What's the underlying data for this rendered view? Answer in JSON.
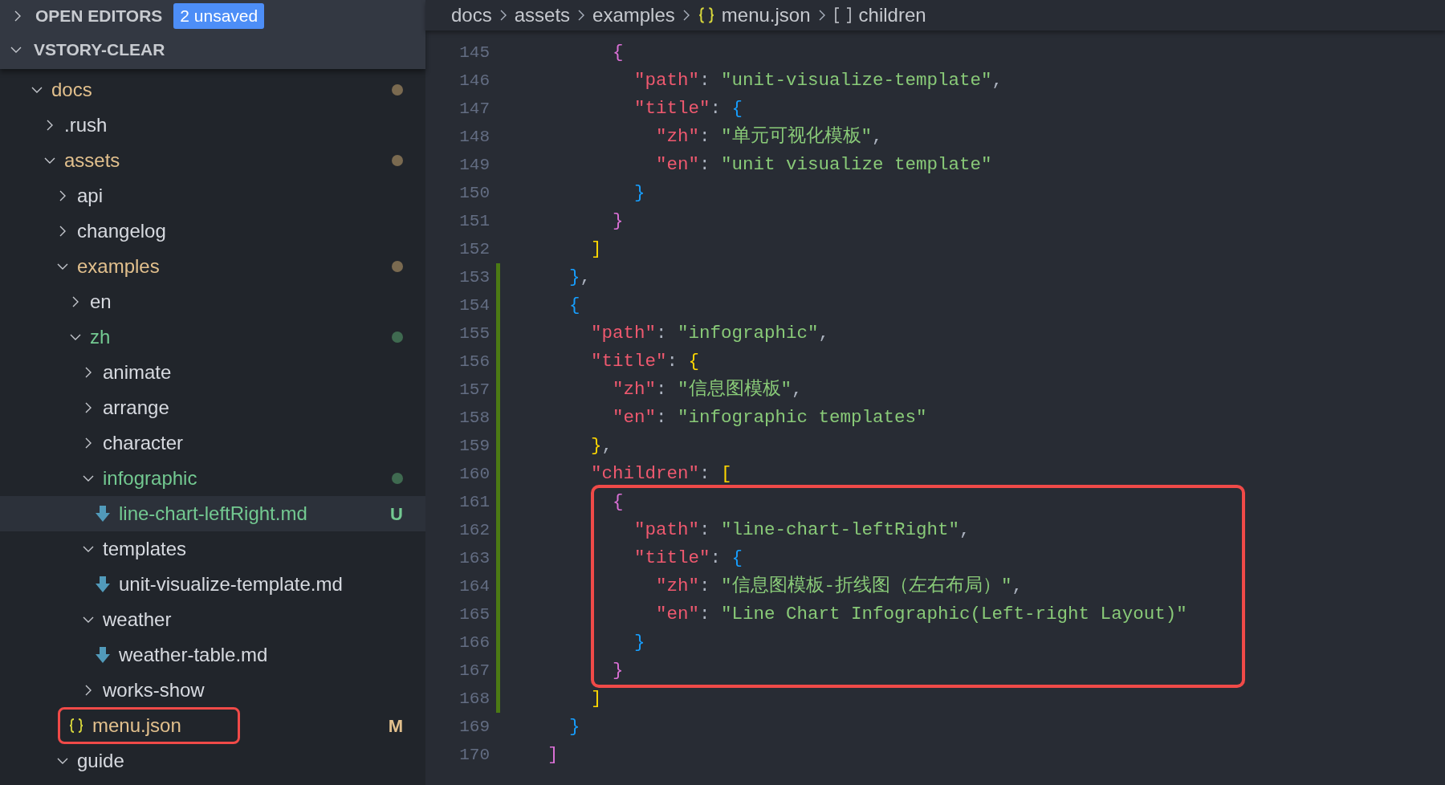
{
  "sidebar": {
    "open_editors": {
      "label": "OPEN EDITORS",
      "expanded": false,
      "badge": "2 unsaved"
    },
    "workspace": {
      "label": "VSTORY-CLEAR",
      "expanded": true
    },
    "tree": [
      {
        "name": "docs",
        "kind": "folder",
        "expanded": true,
        "color": "#e2c08d",
        "dot": {
          "color": "#7a6a50"
        },
        "children": [
          {
            "name": ".rush",
            "kind": "folder",
            "expanded": false
          },
          {
            "name": "assets",
            "kind": "folder",
            "expanded": true,
            "color": "#e2c08d",
            "dot": {
              "color": "#7a6a50"
            },
            "children": [
              {
                "name": "api",
                "kind": "folder",
                "expanded": false
              },
              {
                "name": "changelog",
                "kind": "folder",
                "expanded": false
              },
              {
                "name": "examples",
                "kind": "folder",
                "expanded": true,
                "color": "#e2c08d",
                "dot": {
                  "color": "#7a6a50"
                },
                "children": [
                  {
                    "name": "en",
                    "kind": "folder",
                    "expanded": false
                  },
                  {
                    "name": "zh",
                    "kind": "folder",
                    "expanded": true,
                    "color": "#73c991",
                    "dot": {
                      "color": "#3f6a50"
                    },
                    "children": [
                      {
                        "name": "animate",
                        "kind": "folder",
                        "expanded": false
                      },
                      {
                        "name": "arrange",
                        "kind": "folder",
                        "expanded": false
                      },
                      {
                        "name": "character",
                        "kind": "folder",
                        "expanded": false
                      },
                      {
                        "name": "infographic",
                        "kind": "folder",
                        "expanded": true,
                        "color": "#73c991",
                        "dot": {
                          "color": "#3f6a50"
                        },
                        "children": [
                          {
                            "name": "line-chart-leftRight.md",
                            "kind": "markdown",
                            "color": "#73c991",
                            "letter": "U",
                            "selected": true,
                            "highlighted": false
                          }
                        ]
                      },
                      {
                        "name": "templates",
                        "kind": "folder",
                        "expanded": true,
                        "children": [
                          {
                            "name": "unit-visualize-template.md",
                            "kind": "markdown",
                            "selected": false,
                            "highlighted": false
                          }
                        ]
                      },
                      {
                        "name": "weather",
                        "kind": "folder",
                        "expanded": true,
                        "children": [
                          {
                            "name": "weather-table.md",
                            "kind": "markdown",
                            "selected": false,
                            "highlighted": false
                          }
                        ]
                      },
                      {
                        "name": "works-show",
                        "kind": "folder",
                        "expanded": false
                      }
                    ]
                  },
                  {
                    "name": "menu.json",
                    "kind": "json",
                    "color": "#e2c08d",
                    "letter": "M",
                    "selected": false,
                    "highlighted": true
                  }
                ]
              },
              {
                "name": "guide",
                "kind": "folder",
                "expanded": true
              }
            ]
          }
        ]
      }
    ]
  },
  "breadcrumb": [
    {
      "label": "docs",
      "kind": "folder"
    },
    {
      "label": "assets",
      "kind": "folder"
    },
    {
      "label": "examples",
      "kind": "folder"
    },
    {
      "label": "menu.json",
      "kind": "json"
    },
    {
      "label": "children",
      "kind": "array"
    }
  ],
  "editor": {
    "lines": [
      {
        "number": "145",
        "modified": false,
        "highlighted": false,
        "tokens": [
          {
            "kind": "brace2",
            "text": "      {"
          }
        ]
      },
      {
        "number": "146",
        "modified": false,
        "highlighted": false,
        "tokens": [
          {
            "kind": "key",
            "text": "        \"path\""
          },
          {
            "kind": "punct",
            "text": ": "
          },
          {
            "kind": "string",
            "text": "\"unit-visualize-template\""
          },
          {
            "kind": "punct",
            "text": ","
          }
        ]
      },
      {
        "number": "147",
        "modified": false,
        "highlighted": false,
        "tokens": [
          {
            "kind": "key",
            "text": "        \"title\""
          },
          {
            "kind": "punct",
            "text": ": "
          },
          {
            "kind": "brace3",
            "text": "{"
          }
        ]
      },
      {
        "number": "148",
        "modified": false,
        "highlighted": false,
        "tokens": [
          {
            "kind": "key",
            "text": "          \"zh\""
          },
          {
            "kind": "punct",
            "text": ": "
          },
          {
            "kind": "string",
            "text": "\"单元可视化模板\""
          },
          {
            "kind": "punct",
            "text": ","
          }
        ]
      },
      {
        "number": "149",
        "modified": false,
        "highlighted": false,
        "tokens": [
          {
            "kind": "key",
            "text": "          \"en\""
          },
          {
            "kind": "punct",
            "text": ": "
          },
          {
            "kind": "string",
            "text": "\"unit visualize template\""
          }
        ]
      },
      {
        "number": "150",
        "modified": false,
        "highlighted": false,
        "tokens": [
          {
            "kind": "brace3",
            "text": "        }"
          }
        ]
      },
      {
        "number": "151",
        "modified": false,
        "highlighted": false,
        "tokens": [
          {
            "kind": "brace2",
            "text": "      }"
          }
        ]
      },
      {
        "number": "152",
        "modified": false,
        "highlighted": false,
        "tokens": [
          {
            "kind": "brace1",
            "text": "    ]"
          }
        ]
      },
      {
        "number": "153",
        "modified": true,
        "highlighted": false,
        "tokens": [
          {
            "kind": "brace3",
            "text": "  }"
          },
          {
            "kind": "punct",
            "text": ","
          }
        ]
      },
      {
        "number": "154",
        "modified": true,
        "highlighted": false,
        "tokens": [
          {
            "kind": "brace3",
            "text": "  {"
          }
        ]
      },
      {
        "number": "155",
        "modified": true,
        "highlighted": false,
        "tokens": [
          {
            "kind": "key",
            "text": "    \"path\""
          },
          {
            "kind": "punct",
            "text": ": "
          },
          {
            "kind": "string",
            "text": "\"infographic\""
          },
          {
            "kind": "punct",
            "text": ","
          }
        ]
      },
      {
        "number": "156",
        "modified": true,
        "highlighted": false,
        "tokens": [
          {
            "kind": "key",
            "text": "    \"title\""
          },
          {
            "kind": "punct",
            "text": ": "
          },
          {
            "kind": "brace1",
            "text": "{"
          }
        ]
      },
      {
        "number": "157",
        "modified": true,
        "highlighted": false,
        "tokens": [
          {
            "kind": "key",
            "text": "      \"zh\""
          },
          {
            "kind": "punct",
            "text": ": "
          },
          {
            "kind": "string",
            "text": "\"信息图模板\""
          },
          {
            "kind": "punct",
            "text": ","
          }
        ]
      },
      {
        "number": "158",
        "modified": true,
        "highlighted": false,
        "tokens": [
          {
            "kind": "key",
            "text": "      \"en\""
          },
          {
            "kind": "punct",
            "text": ": "
          },
          {
            "kind": "string",
            "text": "\"infographic templates\""
          }
        ]
      },
      {
        "number": "159",
        "modified": true,
        "highlighted": false,
        "tokens": [
          {
            "kind": "brace1",
            "text": "    }"
          },
          {
            "kind": "punct",
            "text": ","
          }
        ]
      },
      {
        "number": "160",
        "modified": true,
        "highlighted": false,
        "tokens": [
          {
            "kind": "key",
            "text": "    \"children\""
          },
          {
            "kind": "punct",
            "text": ": "
          },
          {
            "kind": "brace1",
            "text": "["
          }
        ]
      },
      {
        "number": "161",
        "modified": true,
        "highlighted": true,
        "tokens": [
          {
            "kind": "brace2",
            "text": "      {"
          }
        ]
      },
      {
        "number": "162",
        "modified": true,
        "highlighted": true,
        "tokens": [
          {
            "kind": "key",
            "text": "        \"path\""
          },
          {
            "kind": "punct",
            "text": ": "
          },
          {
            "kind": "string",
            "text": "\"line-chart-leftRight\""
          },
          {
            "kind": "punct",
            "text": ","
          }
        ]
      },
      {
        "number": "163",
        "modified": true,
        "highlighted": true,
        "tokens": [
          {
            "kind": "key",
            "text": "        \"title\""
          },
          {
            "kind": "punct",
            "text": ": "
          },
          {
            "kind": "brace3",
            "text": "{"
          }
        ]
      },
      {
        "number": "164",
        "modified": true,
        "highlighted": true,
        "tokens": [
          {
            "kind": "key",
            "text": "          \"zh\""
          },
          {
            "kind": "punct",
            "text": ": "
          },
          {
            "kind": "string",
            "text": "\"信息图模板-折线图（左右布局）\""
          },
          {
            "kind": "punct",
            "text": ","
          }
        ]
      },
      {
        "number": "165",
        "modified": true,
        "highlighted": true,
        "tokens": [
          {
            "kind": "key",
            "text": "          \"en\""
          },
          {
            "kind": "punct",
            "text": ": "
          },
          {
            "kind": "string",
            "text": "\"Line Chart Infographic(Left-right Layout)\""
          }
        ]
      },
      {
        "number": "166",
        "modified": true,
        "highlighted": true,
        "tokens": [
          {
            "kind": "brace3",
            "text": "        }"
          }
        ]
      },
      {
        "number": "167",
        "modified": true,
        "highlighted": true,
        "tokens": [
          {
            "kind": "brace2",
            "text": "      }"
          }
        ]
      },
      {
        "number": "168",
        "modified": true,
        "highlighted": false,
        "tokens": [
          {
            "kind": "brace1",
            "text": "    ]"
          }
        ]
      },
      {
        "number": "169",
        "modified": false,
        "highlighted": false,
        "tokens": [
          {
            "kind": "brace3",
            "text": "  }"
          }
        ]
      },
      {
        "number": "170",
        "modified": false,
        "highlighted": false,
        "tokens": [
          {
            "kind": "brace2",
            "text": "]"
          }
        ]
      }
    ]
  }
}
